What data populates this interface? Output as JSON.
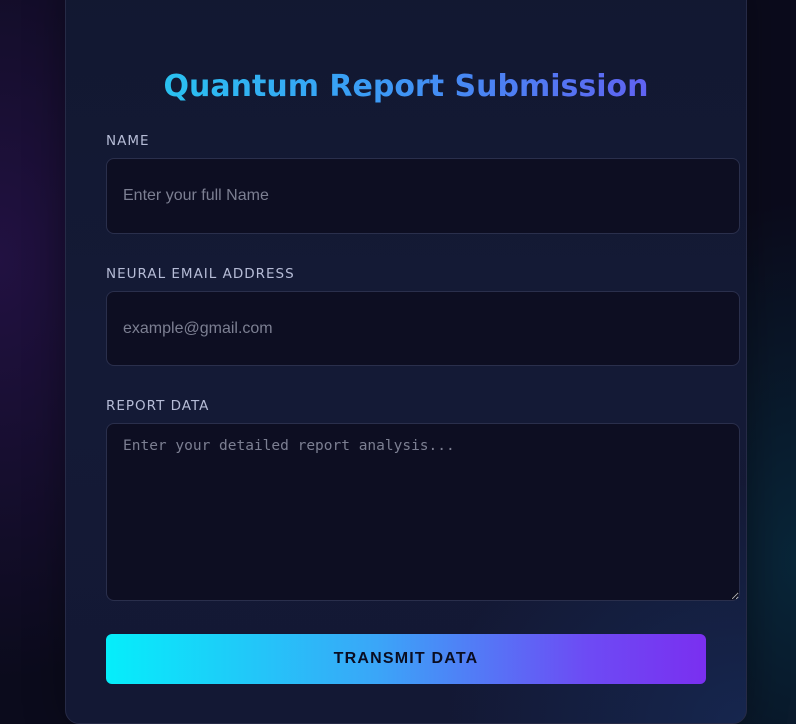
{
  "form": {
    "title": "Quantum Report Submission",
    "name": {
      "label": "NAME",
      "placeholder": "Enter your full Name",
      "value": ""
    },
    "email": {
      "label": "NEURAL EMAIL ADDRESS",
      "placeholder": "example@gmail.com",
      "value": ""
    },
    "report": {
      "label": "REPORT DATA",
      "placeholder": "Enter your detailed report analysis...",
      "value": ""
    },
    "submit_label": "TRANSMIT DATA"
  },
  "colors": {
    "background": "#0b0b1c",
    "card": "#131834",
    "field": "#0d0e22",
    "gradient_start": "#05eefa",
    "gradient_mid": "#3aa6f8",
    "gradient_end": "#7a2ff0",
    "label": "#b6bcd6",
    "placeholder": "#7c7f92"
  }
}
